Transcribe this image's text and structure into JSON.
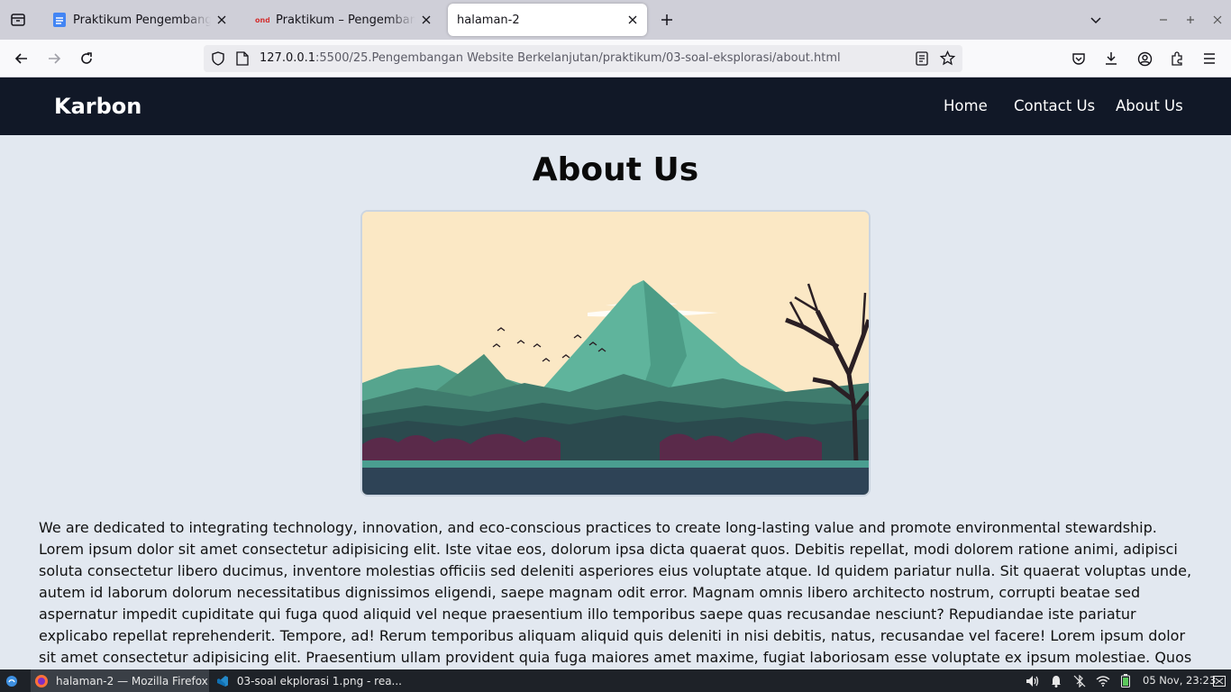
{
  "browser": {
    "tabs": [
      {
        "title": "Praktikum Pengembangan Website Berkelanjutan",
        "icon": "google-docs-icon"
      },
      {
        "title": "Praktikum – Pengembangan Website Berkelanjutan",
        "icon": "site-logo-icon"
      },
      {
        "title": "halaman-2",
        "icon": "none"
      }
    ],
    "url": {
      "host": "127.0.0.1",
      "path": ":5500/25.Pengembangan Website Berkelanjutan/praktikum/03-soal-eksplorasi/about.html"
    }
  },
  "site": {
    "brand": "Karbon",
    "nav": [
      "Home",
      "Contact Us",
      "About Us"
    ],
    "title": "About Us",
    "hero_image": "mountain-landscape-illustration",
    "paragraph": "We are dedicated to integrating technology, innovation, and eco-conscious practices to create long-lasting value and promote environmental stewardship. Lorem ipsum dolor sit amet consectetur adipisicing elit. Iste vitae eos, dolorum ipsa dicta quaerat quos. Debitis repellat, modi dolorem ratione animi, adipisci soluta consectetur libero ducimus, inventore molestias officiis sed deleniti asperiores eius voluptate atque. Id quidem pariatur nulla. Sit quaerat voluptas unde, autem id laborum dolorum necessitatibus dignissimos eligendi, saepe magnam odit error. Magnam omnis libero architecto nostrum, corrupti beatae sed aspernatur impedit cupiditate qui fuga quod aliquid vel neque praesentium illo temporibus saepe quas recusandae nesciunt? Repudiandae iste pariatur explicabo repellat reprehenderit. Tempore, ad! Rerum temporibus aliquam aliquid quis deleniti in nisi debitis, natus, recusandae vel facere! Lorem ipsum dolor sit amet consectetur adipisicing elit. Praesentium ullam provident quia fuga maiores amet maxime, fugiat laboriosam esse voluptate ex ipsum molestiae. Quos nulla, distinctio saepe sunt maxime hic reprehenderit ab. Autem fugiat eum"
  },
  "taskbar": {
    "tasks": [
      {
        "label": "halaman-2 — Mozilla Firefox",
        "icon": "firefox-icon"
      },
      {
        "label": "03-soal ekplorasi 1.png - rea...",
        "icon": "vscode-icon"
      }
    ],
    "clock": "05 Nov, 23:23"
  },
  "colors": {
    "nav_bg": "#111827",
    "page_bg": "#e2e8f0",
    "sky": "#fbe8c5",
    "mountain": "#5fb49c"
  }
}
